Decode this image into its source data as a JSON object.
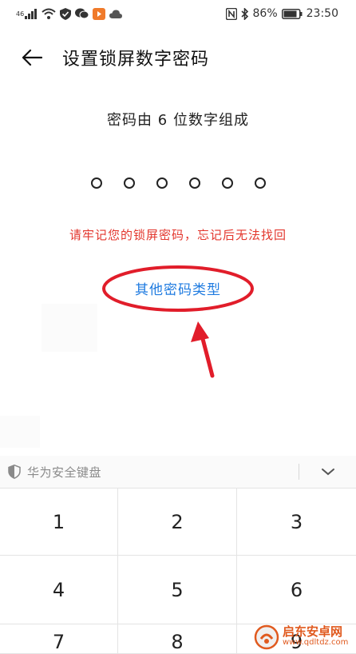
{
  "status_bar": {
    "signal_label": "46",
    "battery_text": "86%",
    "time": "23:50"
  },
  "header": {
    "title": "设置锁屏数字密码"
  },
  "main": {
    "instruction": "密码由 6 位数字组成",
    "pin_length": 6,
    "warning": "请牢记您的锁屏密码，忘记后无法找回",
    "other_types_label": "其他密码类型"
  },
  "keyboard": {
    "title": "华为安全键盘",
    "keys": [
      "1",
      "2",
      "3",
      "4",
      "5",
      "6",
      "7",
      "8",
      "9"
    ]
  },
  "watermark": {
    "text": "启东安卓网",
    "url": "www.qdltdz.com"
  },
  "colors": {
    "accent_blue": "#1f7be0",
    "warning_red": "#e3372e",
    "annotation_red": "#e11d2a"
  }
}
